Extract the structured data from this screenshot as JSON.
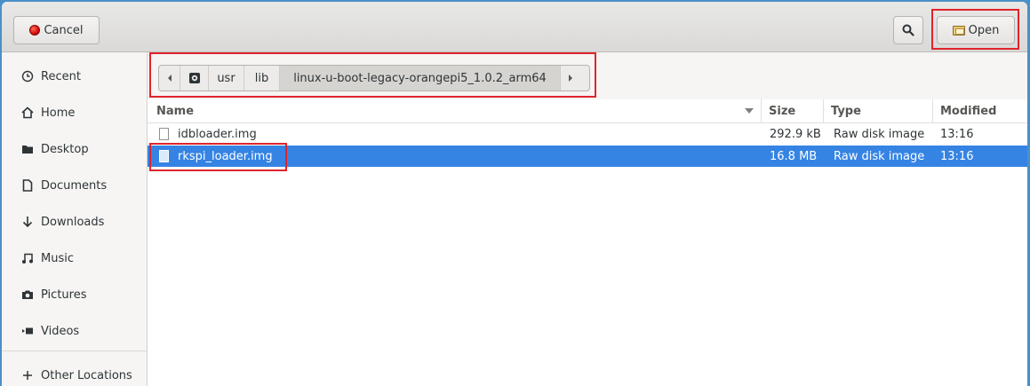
{
  "header": {
    "cancel_label": "Cancel",
    "open_label": "Open"
  },
  "sidebar": {
    "items": [
      {
        "label": "Recent",
        "icon": "clock-icon"
      },
      {
        "label": "Home",
        "icon": "home-icon"
      },
      {
        "label": "Desktop",
        "icon": "folder-icon"
      },
      {
        "label": "Documents",
        "icon": "document-icon"
      },
      {
        "label": "Downloads",
        "icon": "download-arrow-icon"
      },
      {
        "label": "Music",
        "icon": "music-note-icon"
      },
      {
        "label": "Pictures",
        "icon": "camera-icon"
      },
      {
        "label": "Videos",
        "icon": "video-icon"
      },
      {
        "label": "Other Locations",
        "icon": "plus-icon"
      }
    ]
  },
  "pathbar": {
    "segments": [
      "usr",
      "lib",
      "linux-u-boot-legacy-orangepi5_1.0.2_arm64"
    ],
    "active_index": 2
  },
  "filelist": {
    "columns": {
      "name": "Name",
      "size": "Size",
      "type": "Type",
      "modified": "Modified"
    },
    "rows": [
      {
        "name": "idbloader.img",
        "size": "292.9 kB",
        "type": "Raw disk image",
        "modified": "13:16",
        "selected": false
      },
      {
        "name": "rkspi_loader.img",
        "size": "16.8 MB",
        "type": "Raw disk image",
        "modified": "13:16",
        "selected": true
      }
    ]
  },
  "colors": {
    "selection": "#3584e4",
    "highlight_box": "#e0242b",
    "cancel_dot": "#cc0000"
  }
}
